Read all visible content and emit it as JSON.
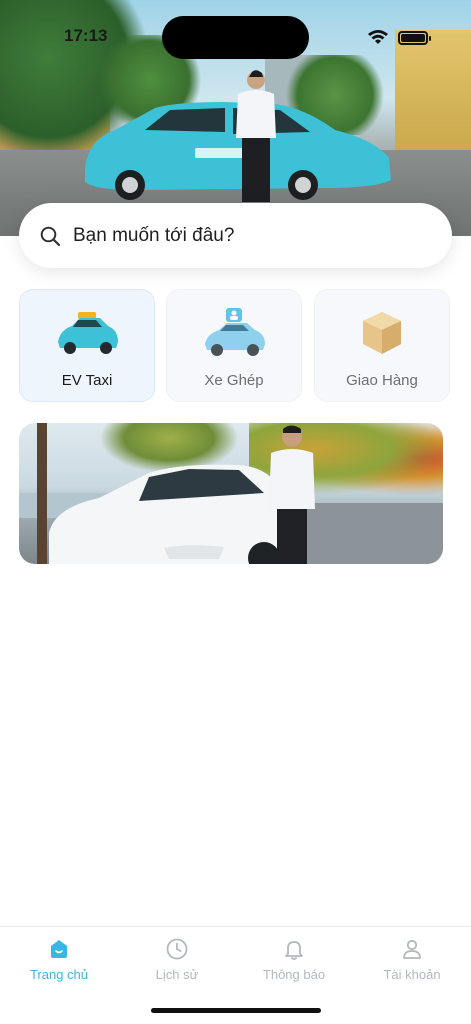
{
  "status": {
    "time": "17:13"
  },
  "search": {
    "placeholder": "Bạn muốn tới đâu?"
  },
  "services": [
    {
      "label": "EV Taxi",
      "active": true
    },
    {
      "label": "Xe Ghép",
      "active": false
    },
    {
      "label": "Giao Hàng",
      "active": false
    }
  ],
  "tabs": [
    {
      "label": "Trang chủ",
      "icon": "home-icon",
      "active": true
    },
    {
      "label": "Lịch sử",
      "icon": "clock-icon",
      "active": false
    },
    {
      "label": "Thông báo",
      "icon": "bell-icon",
      "active": false
    },
    {
      "label": "Tài khoản",
      "icon": "user-icon",
      "active": false
    }
  ],
  "colors": {
    "accent": "#38b6e6",
    "taxi": "#3cc1d6",
    "inactive": "#b4b8bd"
  }
}
